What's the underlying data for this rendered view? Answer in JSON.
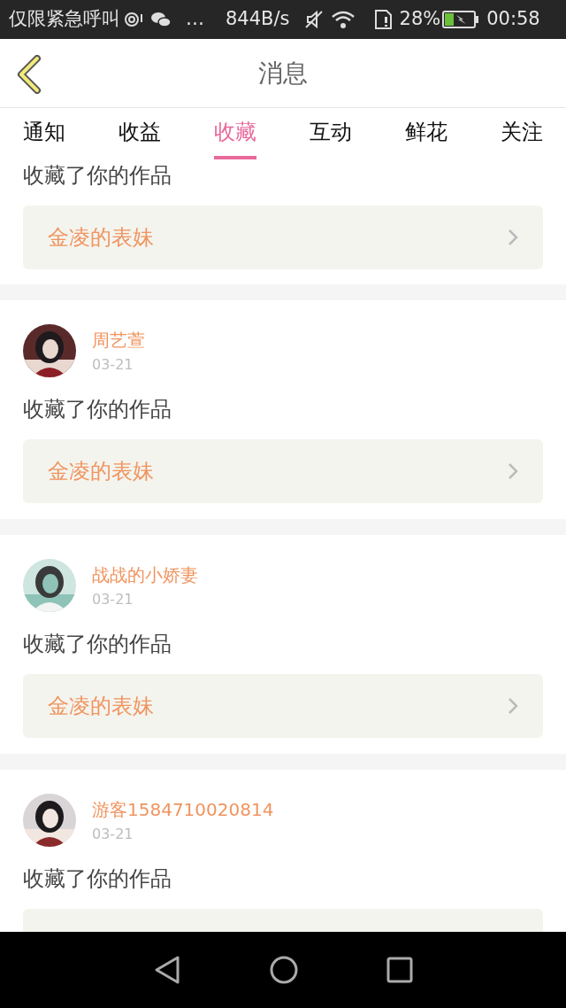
{
  "status_bar": {
    "carrier": "仅限紧急呼叫",
    "more": "…",
    "speed": "844B/s",
    "battery": "28%",
    "time": "00:58"
  },
  "header": {
    "title": "消息"
  },
  "tabs": [
    {
      "label": "通知",
      "selected": false
    },
    {
      "label": "收益",
      "selected": false
    },
    {
      "label": "收藏",
      "selected": true
    },
    {
      "label": "互动",
      "selected": false
    },
    {
      "label": "鲜花",
      "selected": false
    },
    {
      "label": "关注",
      "selected": false
    }
  ],
  "messages": [
    {
      "action": "收藏了你的作品",
      "work": "金凌的表妹"
    },
    {
      "user": "周艺萱",
      "date": "03-21",
      "action": "收藏了你的作品",
      "work": "金凌的表妹"
    },
    {
      "user": "战战的小娇妻",
      "date": "03-21",
      "action": "收藏了你的作品",
      "work": "金凌的表妹"
    },
    {
      "user": "游客1584710020814",
      "date": "03-21",
      "action": "收藏了你的作品"
    }
  ]
}
